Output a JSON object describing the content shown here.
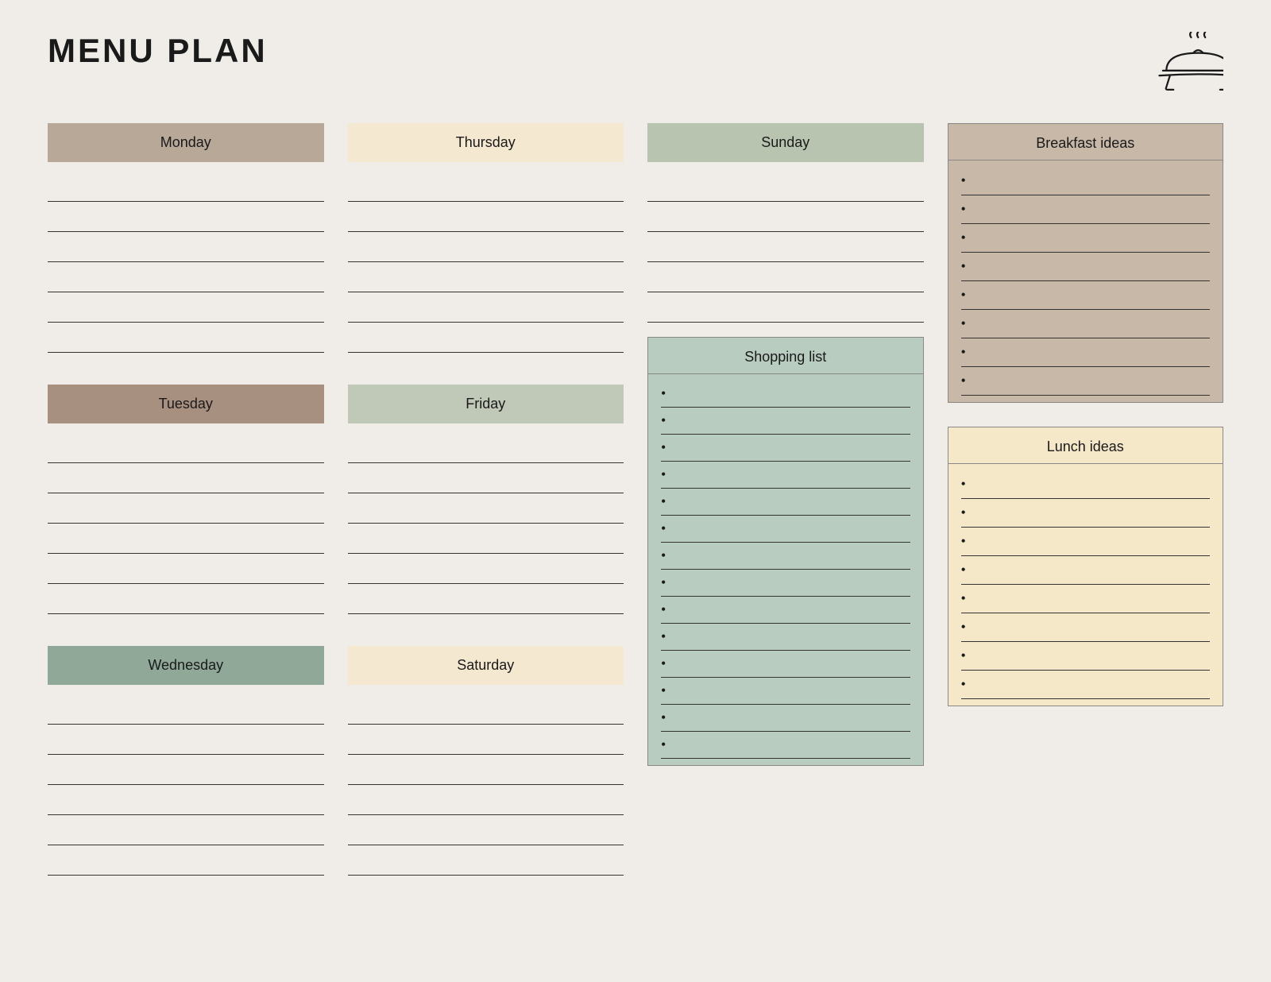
{
  "page": {
    "title": "MENU PLAN",
    "days": {
      "monday": {
        "label": "Monday",
        "color_class": "monday",
        "lines": 6
      },
      "tuesday": {
        "label": "Tuesday",
        "color_class": "tuesday",
        "lines": 6
      },
      "wednesday": {
        "label": "Wednesday",
        "color_class": "wednesday",
        "lines": 6
      },
      "thursday": {
        "label": "Thursday",
        "color_class": "thursday",
        "lines": 6
      },
      "friday": {
        "label": "Friday",
        "color_class": "friday",
        "lines": 6
      },
      "saturday": {
        "label": "Saturday",
        "color_class": "saturday",
        "lines": 6
      },
      "sunday": {
        "label": "Sunday",
        "color_class": "sunday",
        "lines": 5
      }
    },
    "breakfast_ideas": {
      "title": "Breakfast ideas",
      "items": 8
    },
    "lunch_ideas": {
      "title": "Lunch ideas",
      "items": 8
    },
    "shopping_list": {
      "title": "Shopping list",
      "items": 14
    }
  }
}
